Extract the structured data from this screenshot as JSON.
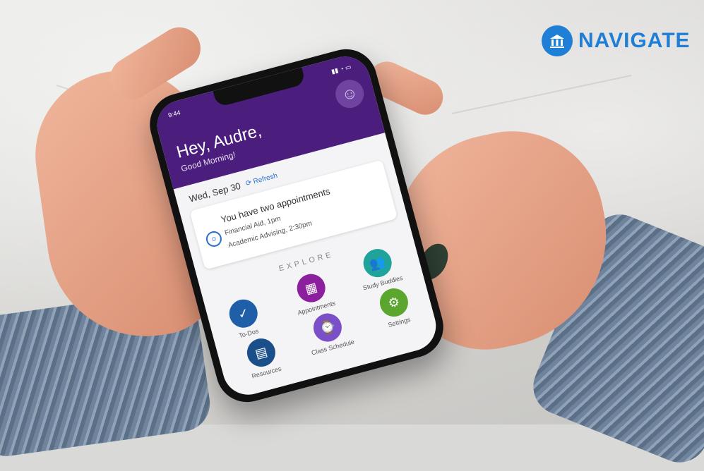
{
  "brand": {
    "name": "NAVIGATE",
    "color": "#1f7fd6",
    "icon": "university-building-icon"
  },
  "status_bar": {
    "time": "9:44",
    "icons": "▮▮ ◔ ▭"
  },
  "header": {
    "greeting": "Hey, Audre,",
    "subtitle": "Good Morning!",
    "color": "#4b1e7d"
  },
  "today": {
    "date": "Wed, Sep 30",
    "refresh_label": "Refresh"
  },
  "appointments": {
    "title": "You have two appointments",
    "items": [
      "Financial Aid, 1pm",
      "Academic Advising, 2:30pm"
    ]
  },
  "explore": {
    "heading": "EXPLORE",
    "tiles": [
      {
        "label": "To-Dos",
        "color": "#1e5fa8",
        "icon": "todo-icon"
      },
      {
        "label": "Appointments",
        "color": "#8b1f9e",
        "icon": "calendar-icon"
      },
      {
        "label": "Study Buddies",
        "color": "#1fa39a",
        "icon": "people-icon"
      },
      {
        "label": "Resources",
        "color": "#1b4f8a",
        "icon": "book-icon"
      },
      {
        "label": "Class Schedule",
        "color": "#7a4fc7",
        "icon": "schedule-icon"
      },
      {
        "label": "Settings",
        "color": "#5aa62f",
        "icon": "gear-icon"
      }
    ]
  }
}
